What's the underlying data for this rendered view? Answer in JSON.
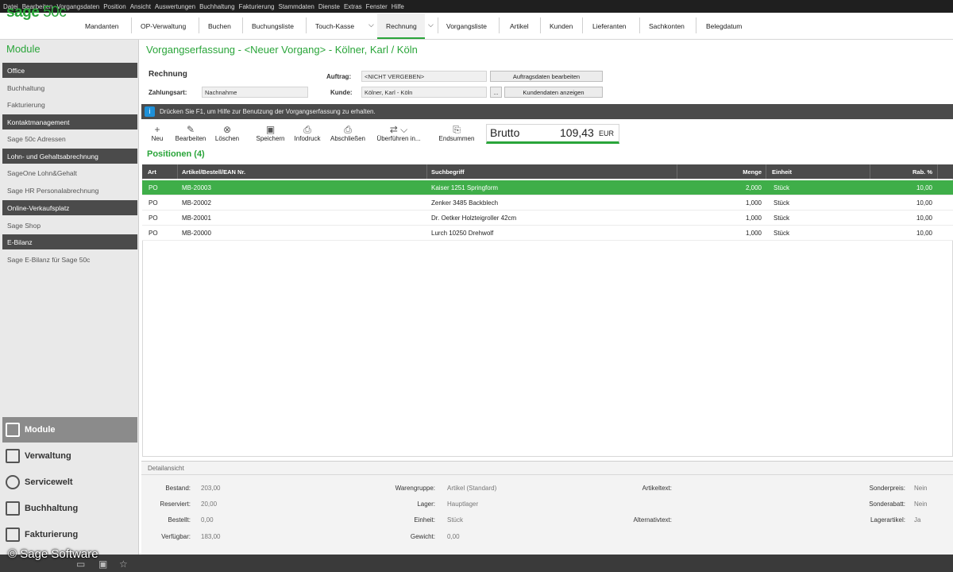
{
  "menubar": [
    "Datei",
    "Bearbeiten",
    "Vorgangsdaten",
    "Position",
    "Ansicht",
    "Auswertungen",
    "Buchhaltung",
    "Fakturierung",
    "Stammdaten",
    "Dienste",
    "Extras",
    "Fenster",
    "Hilfe"
  ],
  "app": {
    "logo": "sage",
    "version": "50c"
  },
  "nav": [
    "Mandanten",
    "OP-Verwaltung",
    "Buchen",
    "Buchungsliste",
    "Touch-Kasse",
    "Rechnung",
    "Vorgangsliste",
    "Artikel",
    "Kunden",
    "Lieferanten",
    "Sachkonten",
    "Belegdatum"
  ],
  "sidebar": {
    "title": "Module",
    "office_head": "Office",
    "office_items": [
      "Buchhaltung",
      "Fakturierung"
    ],
    "km_head": "Kontaktmanagement",
    "km_items": [
      "Sage 50c Adressen"
    ],
    "lohn_head": "Lohn- und Gehaltsabrechnung",
    "lohn_items": [
      "SageOne Lohn&Gehalt",
      "Sage HR Personalabrechnung"
    ],
    "ov_head": "Online-Verkaufsplatz",
    "ov_items": [
      "Sage Shop"
    ],
    "eb_head": "E-Bilanz",
    "eb_items": [
      "Sage E-Bilanz für Sage 50c"
    ],
    "bottom": [
      "Module",
      "Verwaltung",
      "Servicewelt",
      "Buchhaltung",
      "Fakturierung"
    ]
  },
  "main": {
    "title": "Vorgangserfassung - <Neuer Vorgang> - Kölner, Karl / Köln",
    "doc_type": "Rechnung",
    "zahlungsart_label": "Zahlungsart:",
    "zahlungsart_value": "Nachnahme",
    "auftrag_label": "Auftrag:",
    "auftrag_value": "<NICHT VERGEBEN>",
    "auftrag_btn": "Auftragsdaten bearbeiten",
    "kunde_label": "Kunde:",
    "kunde_value": "Kölner, Karl - Köln",
    "kunde_dots": "...",
    "kunde_btn": "Kundendaten anzeigen",
    "info": "Drücken Sie F1, um Hilfe zur Benutzung der Vorgangserfassung zu erhalten."
  },
  "toolbar": [
    "Neu",
    "Bearbeiten",
    "Löschen",
    "Speichern",
    "Infodruck",
    "Abschließen",
    "Überführen in...",
    "Endsummen"
  ],
  "brutto": {
    "label": "Brutto",
    "value": "109,43",
    "currency": "EUR"
  },
  "positions": {
    "title": "Positionen (4)",
    "headers": [
      "Art",
      "Artikel/Bestell/EAN Nr.",
      "Suchbegriff",
      "Menge",
      "Einheit",
      "Rab. %"
    ],
    "rows": [
      {
        "art": "PO",
        "nr": "MB-20003",
        "such": "Kaiser 1251 Springform",
        "menge": "2,000",
        "einheit": "Stück",
        "rab": "10,00"
      },
      {
        "art": "PO",
        "nr": "MB-20002",
        "such": "Zenker 3485 Backblech",
        "menge": "1,000",
        "einheit": "Stück",
        "rab": "10,00"
      },
      {
        "art": "PO",
        "nr": "MB-20001",
        "such": "Dr. Oetker Holzteigroller 42cm",
        "menge": "1,000",
        "einheit": "Stück",
        "rab": "10,00"
      },
      {
        "art": "PO",
        "nr": "MB-20000",
        "such": "Lurch 10250 Drehwolf",
        "menge": "1,000",
        "einheit": "Stück",
        "rab": "10,00"
      }
    ]
  },
  "detail": {
    "title": "Detailansicht",
    "col1": [
      {
        "l": "Bestand:",
        "v": "203,00"
      },
      {
        "l": "Reserviert:",
        "v": "20,00"
      },
      {
        "l": "Bestellt:",
        "v": "0,00"
      },
      {
        "l": "Verfügbar:",
        "v": "183,00"
      }
    ],
    "col2": [
      {
        "l": "Warengruppe:",
        "v": "Artikel (Standard)"
      },
      {
        "l": "Lager:",
        "v": "Hauptlager"
      },
      {
        "l": "Einheit:",
        "v": "Stück"
      },
      {
        "l": "Gewicht:",
        "v": "0,00"
      }
    ],
    "col3": [
      {
        "l": "Artikeltext:",
        "v": ""
      },
      {
        "l": "Alternativtext:",
        "v": ""
      }
    ],
    "col4": [
      {
        "l": "Sonderpreis:",
        "v": "Nein"
      },
      {
        "l": "Sonderabatt:",
        "v": "Nein"
      },
      {
        "l": "Lagerartikel:",
        "v": "Ja"
      }
    ]
  },
  "copyright": "© Sage Software",
  "colors": {
    "accent": "#2aa53a",
    "selected_row": "#3fae49",
    "dark_bar": "#4b4b4b",
    "info": "#1e90d8"
  }
}
